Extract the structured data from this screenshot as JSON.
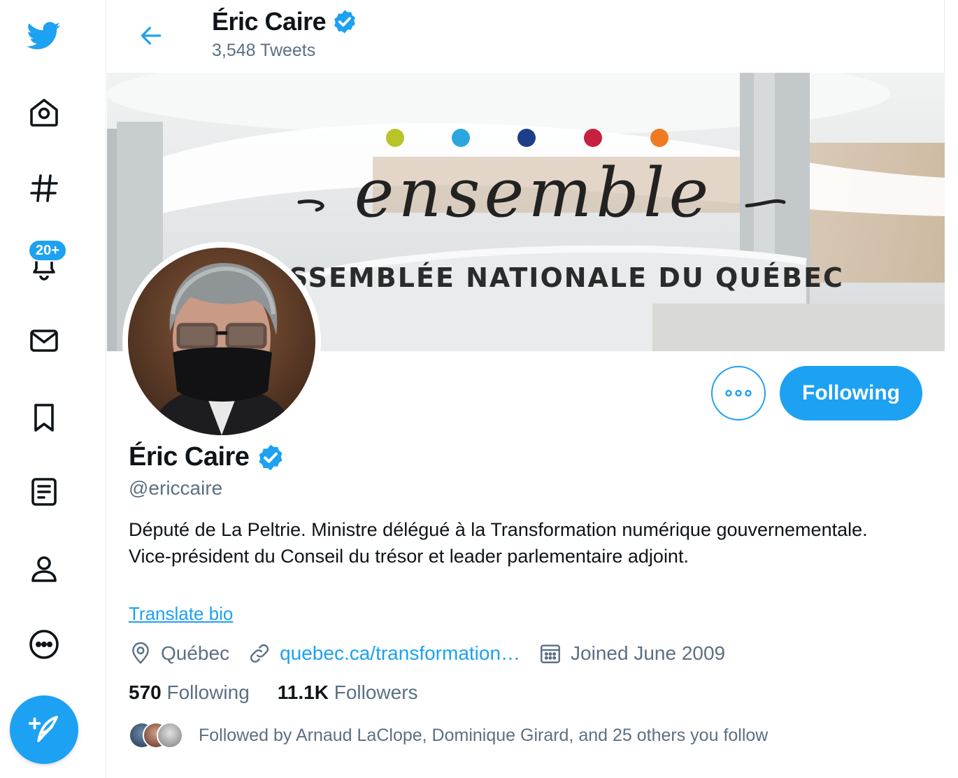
{
  "sidebar": {
    "items": [
      {
        "icon": "twitter-logo-icon"
      },
      {
        "icon": "home-icon"
      },
      {
        "icon": "explore-hashtag-icon"
      },
      {
        "icon": "notifications-bell-icon",
        "badge": "20+"
      },
      {
        "icon": "messages-mail-icon"
      },
      {
        "icon": "bookmarks-icon"
      },
      {
        "icon": "lists-icon"
      },
      {
        "icon": "profile-icon"
      },
      {
        "icon": "more-icon"
      }
    ],
    "compose_icon": "compose-tweet-icon",
    "notifications_badge": "20+"
  },
  "header": {
    "name": "Éric Caire",
    "tweet_count": "3,548 Tweets"
  },
  "banner": {
    "script_word": "ensemble",
    "caption": "SSEMBLÉE NATIONALE DU QUÉBEC",
    "dot_colors": [
      "#b7c52a",
      "#2aa6de",
      "#1d3f8a",
      "#c8203f",
      "#f07a22"
    ]
  },
  "profile": {
    "name": "Éric Caire",
    "handle": "@ericcaire",
    "bio": "Député de La Peltrie. Ministre délégué à la Transformation numérique gouvernementale. Vice-président du Conseil du trésor et leader parlementaire adjoint.",
    "translate_label": "Translate bio",
    "location": "Québec",
    "website": "quebec.ca/transformation…",
    "joined": "Joined June 2009",
    "following_count": "570",
    "following_label": "Following",
    "followers_count": "11.1K",
    "followers_label": "Followers",
    "followed_by": "Followed by Arnaud LaClope, Dominique Girard, and 25 others you follow",
    "follow_button": "Following"
  },
  "colors": {
    "accent": "#1da1f2",
    "secondary_text": "#5b7083",
    "primary_text": "#0f1419"
  }
}
